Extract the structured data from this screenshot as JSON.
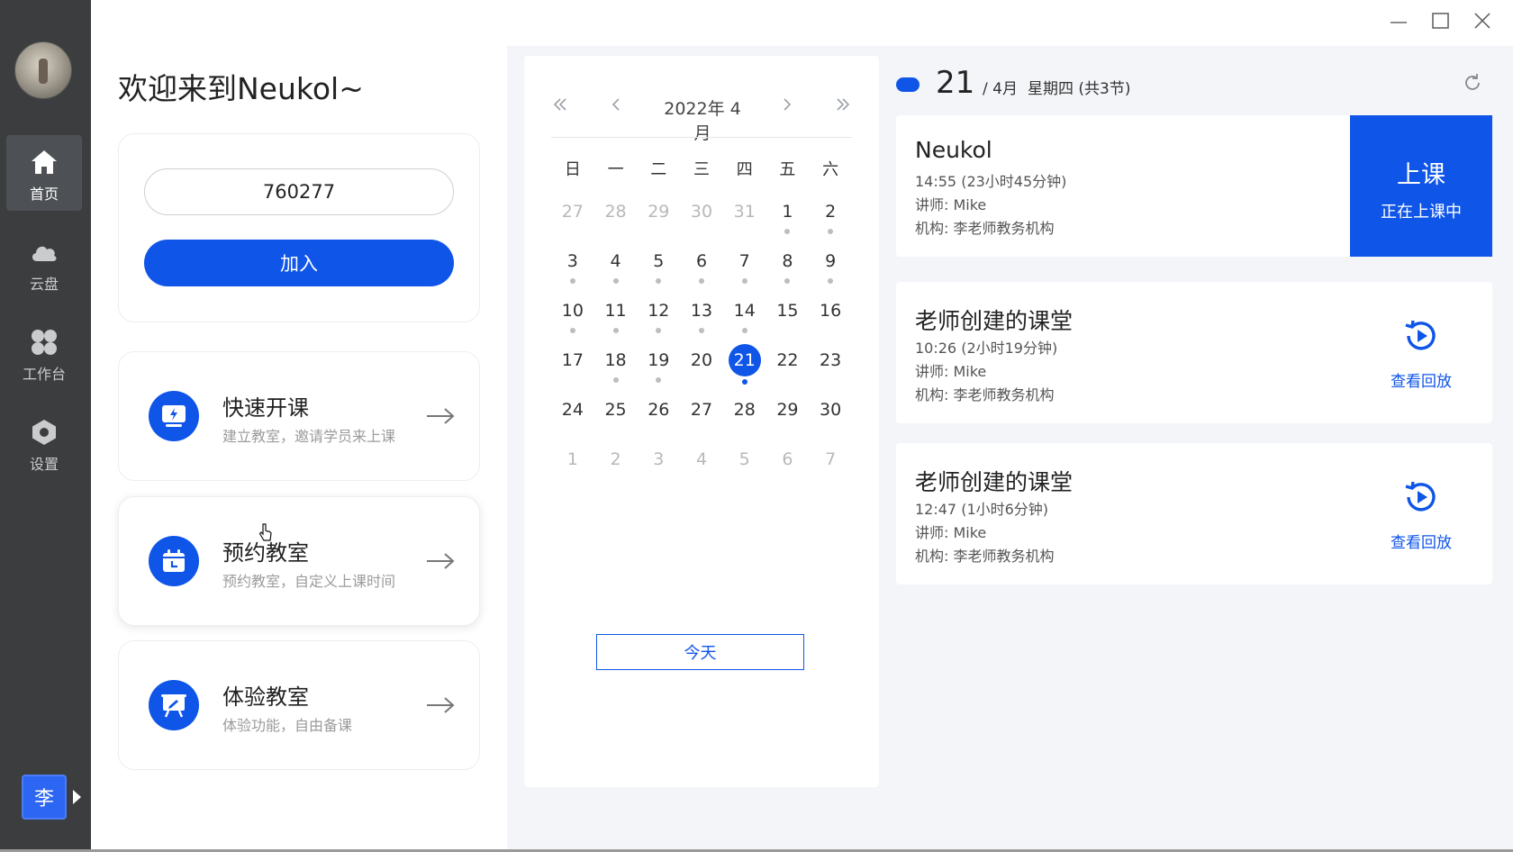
{
  "sidebar": {
    "items": [
      {
        "label": "首页",
        "icon": "home-icon"
      },
      {
        "label": "云盘",
        "icon": "cloud-icon"
      },
      {
        "label": "工作台",
        "icon": "workspace-icon"
      },
      {
        "label": "设置",
        "icon": "settings-icon"
      }
    ],
    "user_initial": "李"
  },
  "welcome": "欢迎来到Neukol~",
  "join": {
    "room_code": "760277",
    "button": "加入"
  },
  "actions": [
    {
      "title": "快速开课",
      "subtitle": "建立教室，邀请学员来上课"
    },
    {
      "title": "预约教室",
      "subtitle": "预约教室，自定义上课时间"
    },
    {
      "title": "体验教室",
      "subtitle": "体验功能，自由备课"
    }
  ],
  "calendar": {
    "month_label": "2022年 4月",
    "weekdays": [
      "日",
      "一",
      "二",
      "三",
      "四",
      "五",
      "六"
    ],
    "today_button": "今天",
    "weeks": [
      [
        [
          "27",
          1,
          0,
          0
        ],
        [
          "28",
          1,
          0,
          0
        ],
        [
          "29",
          1,
          0,
          0
        ],
        [
          "30",
          1,
          0,
          0
        ],
        [
          "31",
          1,
          0,
          0
        ],
        [
          "1",
          0,
          1,
          0
        ],
        [
          "2",
          0,
          1,
          0
        ]
      ],
      [
        [
          "3",
          0,
          1,
          0
        ],
        [
          "4",
          0,
          1,
          0
        ],
        [
          "5",
          0,
          1,
          0
        ],
        [
          "6",
          0,
          1,
          0
        ],
        [
          "7",
          0,
          1,
          0
        ],
        [
          "8",
          0,
          1,
          0
        ],
        [
          "9",
          0,
          1,
          0
        ]
      ],
      [
        [
          "10",
          0,
          1,
          0
        ],
        [
          "11",
          0,
          1,
          0
        ],
        [
          "12",
          0,
          1,
          0
        ],
        [
          "13",
          0,
          1,
          0
        ],
        [
          "14",
          0,
          1,
          0
        ],
        [
          "15",
          0,
          0,
          0
        ],
        [
          "16",
          0,
          0,
          0
        ]
      ],
      [
        [
          "17",
          0,
          0,
          0
        ],
        [
          "18",
          0,
          1,
          0
        ],
        [
          "19",
          0,
          1,
          0
        ],
        [
          "20",
          0,
          0,
          0
        ],
        [
          "21",
          0,
          1,
          1
        ],
        [
          "22",
          0,
          0,
          0
        ],
        [
          "23",
          0,
          0,
          0
        ]
      ],
      [
        [
          "24",
          0,
          0,
          0
        ],
        [
          "25",
          0,
          0,
          0
        ],
        [
          "26",
          0,
          0,
          0
        ],
        [
          "27",
          0,
          0,
          0
        ],
        [
          "28",
          0,
          0,
          0
        ],
        [
          "29",
          0,
          0,
          0
        ],
        [
          "30",
          0,
          0,
          0
        ]
      ],
      [
        [
          "1",
          1,
          0,
          0
        ],
        [
          "2",
          1,
          0,
          0
        ],
        [
          "3",
          1,
          0,
          0
        ],
        [
          "4",
          1,
          0,
          0
        ],
        [
          "5",
          1,
          0,
          0
        ],
        [
          "6",
          1,
          0,
          0
        ],
        [
          "7",
          1,
          0,
          0
        ]
      ]
    ]
  },
  "day": {
    "date": "21",
    "month": "/ 4月",
    "weekday": "星期四 (共3节)"
  },
  "lessons": [
    {
      "title": "Neukol",
      "time": "14:55   (23小时45分钟)",
      "teacher": "讲师: Mike",
      "org": "机构: 李老师教务机构",
      "status": "live",
      "action_big": "上课",
      "action_small": "正在上课中"
    },
    {
      "title": "老师创建的课堂",
      "time": "10:26   (2小时19分钟)",
      "teacher": "讲师: Mike",
      "org": "机构: 李老师教务机构",
      "status": "replay",
      "action_label": "查看回放"
    },
    {
      "title": "老师创建的课堂",
      "time": "12:47   (1小时6分钟)",
      "teacher": "讲师: Mike",
      "org": "机构: 李老师教务机构",
      "status": "replay",
      "action_label": "查看回放"
    }
  ],
  "colors": {
    "accent": "#0f55e8",
    "sidebar": "#3b3d3f",
    "panel_bg": "#f3f5f8"
  }
}
